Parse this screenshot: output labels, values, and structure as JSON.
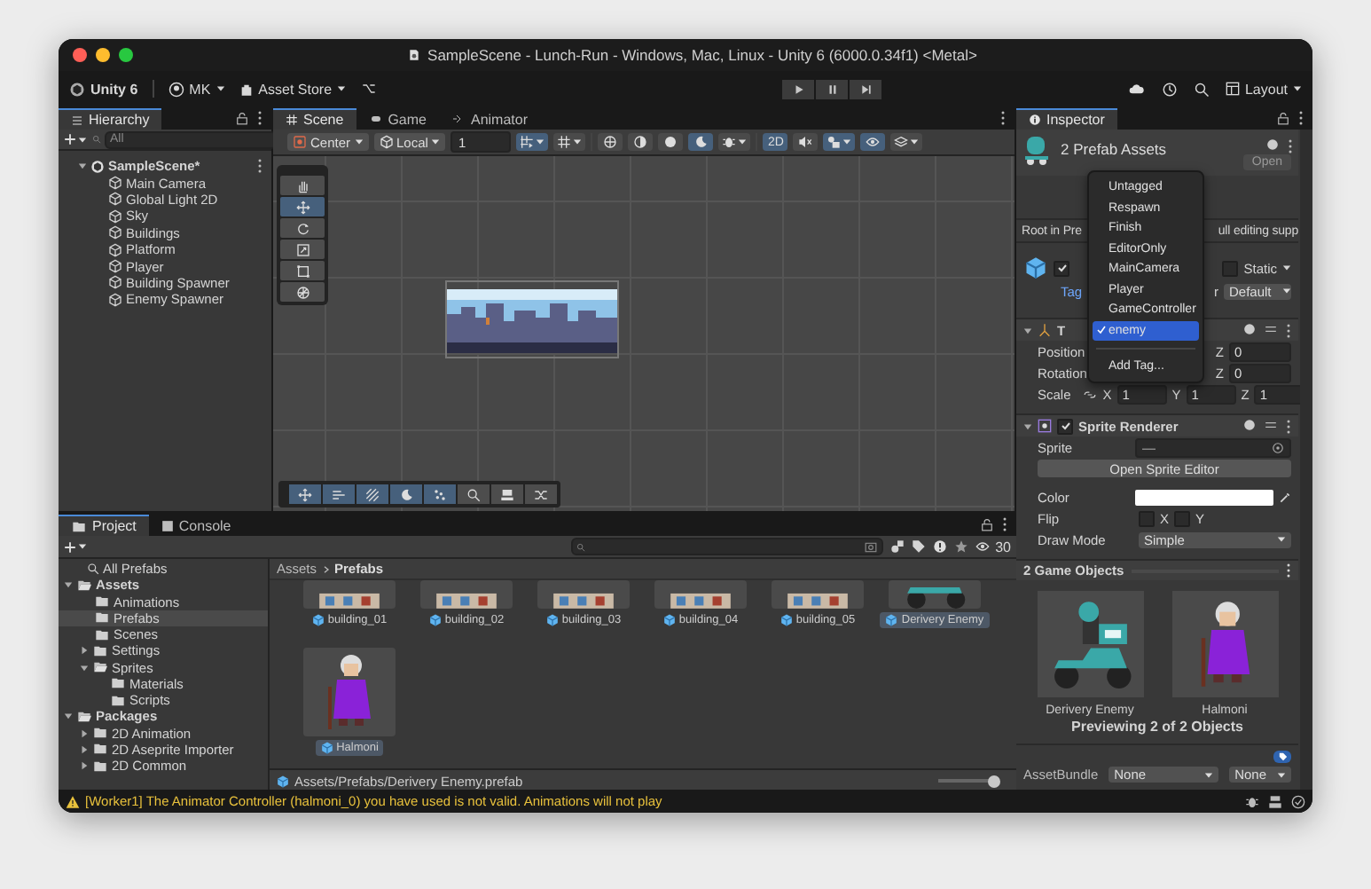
{
  "window": {
    "title": "SampleScene - Lunch-Run - Windows, Mac, Linux - Unity 6 (6000.0.34f1) <Metal>"
  },
  "toolbar": {
    "product": "Unity 6",
    "account": "MK",
    "store": "Asset Store",
    "layout": "Layout"
  },
  "hierarchy": {
    "tab": "Hierarchy",
    "search": {
      "placeholder": "All"
    },
    "scene": {
      "label": "SampleScene*",
      "expanded": true,
      "children": [
        {
          "label": "Main Camera"
        },
        {
          "label": "Global Light 2D"
        },
        {
          "label": "Sky"
        },
        {
          "label": "Buildings"
        },
        {
          "label": "Platform"
        },
        {
          "label": "Player"
        },
        {
          "label": "Building Spawner"
        },
        {
          "label": "Enemy Spawner"
        }
      ]
    }
  },
  "scene": {
    "tabs": [
      {
        "label": "Scene",
        "selected": true
      },
      {
        "label": "Game",
        "selected": false
      },
      {
        "label": "Animator",
        "selected": false
      }
    ],
    "toolbar": [
      {
        "kind": "dropdown",
        "label": "Center"
      },
      {
        "kind": "dropdown",
        "label": "Local"
      },
      {
        "kind": "field",
        "value": "1"
      },
      {
        "kind": "snap",
        "on": true,
        "menu": true
      },
      {
        "kind": "grid",
        "on": false,
        "menu": true
      },
      {
        "kind": "globe",
        "on": false
      },
      {
        "kind": "half",
        "on": false
      },
      {
        "kind": "sphere",
        "on": false
      },
      {
        "kind": "crescent",
        "on": true
      },
      {
        "kind": "bug",
        "on": false,
        "menu": true
      },
      {
        "kind": "text",
        "label": "2D",
        "on": true
      },
      {
        "kind": "mute",
        "on": false
      },
      {
        "kind": "effects",
        "on": true,
        "menu": true
      },
      {
        "kind": "eye",
        "on": true
      },
      {
        "kind": "layers",
        "on": false,
        "menu": true
      }
    ],
    "tools": [
      {
        "kind": "hand",
        "selected": false
      },
      {
        "kind": "move",
        "selected": true
      },
      {
        "kind": "rotate",
        "selected": false
      },
      {
        "kind": "scale",
        "selected": false
      },
      {
        "kind": "rect",
        "selected": false
      },
      {
        "kind": "transform",
        "selected": false
      }
    ],
    "overlay": [
      {
        "kind": "move",
        "on": true
      },
      {
        "kind": "align",
        "on": true
      },
      {
        "kind": "hatch",
        "on": true
      },
      {
        "kind": "crescent",
        "on": true
      },
      {
        "kind": "dots",
        "on": true
      },
      {
        "kind": "search",
        "on": false
      },
      {
        "kind": "stamp",
        "on": false
      },
      {
        "kind": "shuffle",
        "on": false
      }
    ]
  },
  "inspector": {
    "tab": "Inspector",
    "header": {
      "title": "2 Prefab Assets",
      "open": "Open"
    },
    "notice": [
      "Root in Pre",
      "ull editing supp"
    ],
    "object": {
      "active": true,
      "static_label": "Static",
      "static": false,
      "tag_label": "Tag",
      "layer_fragment": "r",
      "layer": "Default"
    },
    "tag_menu": {
      "items": [
        {
          "label": "Untagged",
          "selected": false
        },
        {
          "label": "Respawn",
          "selected": false
        },
        {
          "label": "Finish",
          "selected": false
        },
        {
          "label": "EditorOnly",
          "selected": false
        },
        {
          "label": "MainCamera",
          "selected": false
        },
        {
          "label": "Player",
          "selected": false
        },
        {
          "label": "GameController",
          "selected": false
        },
        {
          "label": "enemy",
          "selected": true
        }
      ],
      "add": "Add Tag..."
    },
    "transform": {
      "title": "T",
      "expanded": true,
      "rows": [
        {
          "label": "Position",
          "fields": [
            {
              "axis": "Z",
              "value": "0"
            }
          ]
        },
        {
          "label": "Rotation",
          "fields": [
            {
              "axis": "Z",
              "value": "0"
            }
          ]
        },
        {
          "label": "Scale",
          "fields": [
            {
              "axis": "X",
              "value": "1"
            },
            {
              "axis": "Y",
              "value": "1"
            },
            {
              "axis": "Z",
              "value": "1"
            }
          ]
        }
      ]
    },
    "sprite_renderer": {
      "title": "Sprite Renderer",
      "enabled": true,
      "expanded": true,
      "sprite_label": "Sprite",
      "sprite": "—",
      "editor_button": "Open Sprite Editor",
      "color_label": "Color",
      "flip_label": "Flip",
      "flip": [
        {
          "axis": "X",
          "checked": false
        },
        {
          "axis": "Y",
          "checked": false
        }
      ],
      "draw_mode_label": "Draw Mode",
      "draw_mode": "Simple"
    },
    "preview": {
      "title": "2 Game Objects",
      "items": [
        {
          "label": "Derivery Enemy",
          "kind": "scooter"
        },
        {
          "label": "Halmoni",
          "kind": "figure"
        }
      ],
      "caption": "Previewing 2 of 2 Objects"
    },
    "asset_bundle": {
      "label": "AssetBundle",
      "name": "None",
      "variant": "None"
    }
  },
  "project": {
    "tabs": [
      {
        "label": "Project",
        "selected": true
      },
      {
        "label": "Console",
        "selected": false
      }
    ],
    "count": "30",
    "tree": [
      {
        "label": "All Prefabs",
        "kind": "search",
        "selected": false
      },
      {
        "label": "Assets",
        "kind": "root",
        "expanded": true,
        "selected": false,
        "children": [
          {
            "label": "Animations",
            "selected": false
          },
          {
            "label": "Prefabs",
            "selected": true
          },
          {
            "label": "Scenes",
            "selected": false
          },
          {
            "label": "Settings",
            "expanded": false,
            "selected": false
          },
          {
            "label": "Sprites",
            "expanded": true,
            "selected": false,
            "children": [
              {
                "label": "Materials",
                "selected": false
              },
              {
                "label": "Scripts",
                "selected": false
              }
            ]
          }
        ]
      },
      {
        "label": "Packages",
        "kind": "root",
        "expanded": true,
        "selected": false,
        "children": [
          {
            "label": "2D Animation",
            "expanded": false,
            "selected": false
          },
          {
            "label": "2D Aseprite Importer",
            "expanded": false,
            "selected": false
          },
          {
            "label": "2D Common",
            "expanded": false,
            "selected": false
          }
        ]
      }
    ],
    "breadcrumb": [
      "Assets",
      "Prefabs"
    ],
    "assets": [
      {
        "label": "building_01",
        "kind": "building",
        "selected": false
      },
      {
        "label": "building_02",
        "kind": "building",
        "selected": false
      },
      {
        "label": "building_03",
        "kind": "building",
        "selected": false
      },
      {
        "label": "building_04",
        "kind": "building",
        "selected": false
      },
      {
        "label": "building_05",
        "kind": "building",
        "selected": false
      },
      {
        "label": "Derivery Enemy",
        "kind": "scooter",
        "selected": true
      },
      {
        "label": "Halmoni",
        "kind": "figure",
        "selected": true
      }
    ],
    "path": "Assets/Prefabs/Derivery Enemy.prefab",
    "zoom": {
      "level": 0.92
    }
  },
  "status": {
    "kind": "warning",
    "message": "[Worker1] The Animator Controller (halmoni_0) you have used is not valid. Animations will not play"
  }
}
